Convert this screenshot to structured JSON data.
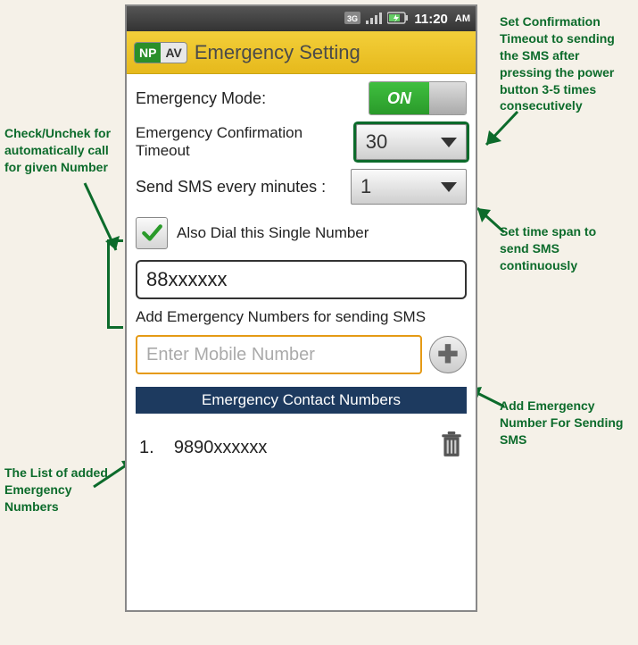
{
  "status": {
    "time": "11:20",
    "ampm": "AM"
  },
  "logo": {
    "np": "NP",
    "av": "AV"
  },
  "title": "Emergency Setting",
  "rows": {
    "mode_label": "Emergency Mode:",
    "mode_value": "ON",
    "timeout_label": "Emergency Confirmation Timeout",
    "timeout_value": "30",
    "interval_label": "Send SMS every minutes :",
    "interval_value": "1"
  },
  "dial": {
    "check_label": "Also Dial this Single Number",
    "number": "88xxxxxx"
  },
  "add": {
    "label": "Add Emergency Numbers for sending SMS",
    "placeholder": "Enter Mobile Number"
  },
  "list": {
    "header": "Emergency Contact Numbers",
    "item1_index": "1.",
    "item1_number": "9890xxxxxx"
  },
  "annotations": {
    "a1": "Set Confirmation Timeout to sending the SMS after pressing the power button 3-5 times consecutively",
    "a2": "Set time span to send SMS continuously",
    "a3": "Add Emergency Number For Sending SMS",
    "a4": "Check/Unchek for automatically call for given Number",
    "a5": "The List of added Emergency Numbers"
  }
}
